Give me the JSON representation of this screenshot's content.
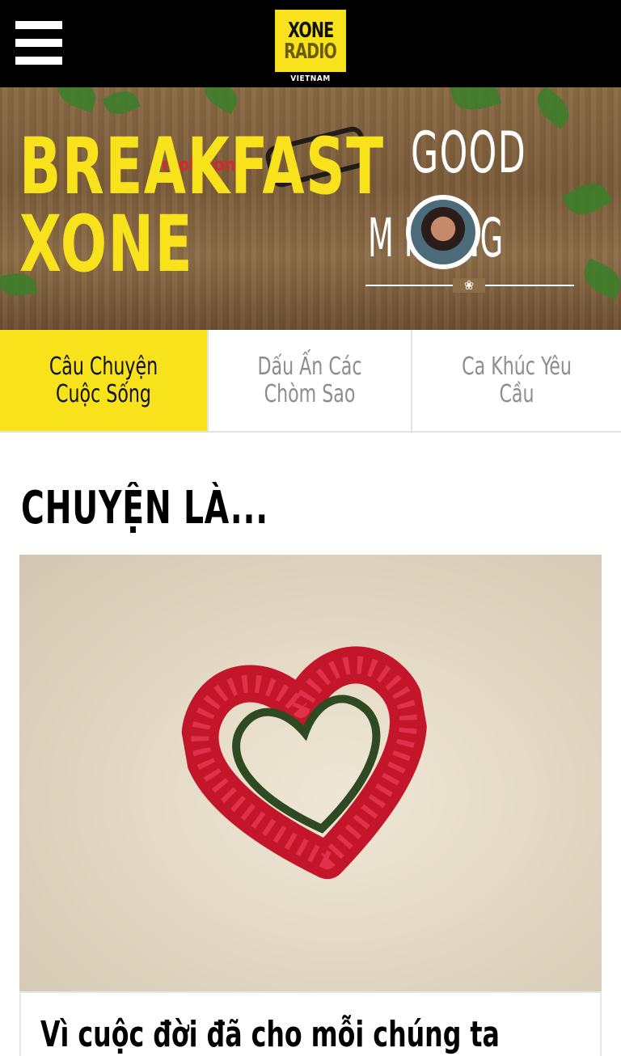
{
  "header": {
    "menu_icon": "hamburger-menu-icon",
    "logo": {
      "line1": "XONE",
      "line2": "RADIO",
      "sub": "VIETNAM"
    }
  },
  "banner": {
    "title_line1": "BREAKFAST",
    "title_line2": "XONE",
    "sponsor": "mobifone",
    "greeting_top": "GOOD",
    "greeting_bottom": "M  RNING"
  },
  "tabs": [
    {
      "label": "Câu Chuyện Cuộc Sống",
      "active": true
    },
    {
      "label": "Dấu Ấn Các Chòm Sao",
      "active": false
    },
    {
      "label": "Ca Khúc Yêu Cầu",
      "active": false
    }
  ],
  "section": {
    "title": "CHUYỆN LÀ...",
    "article": {
      "title": "Vì cuộc đời đã cho mỗi chúng ta",
      "image": "rose-heart-image"
    }
  },
  "colors": {
    "accent": "#f7e21c",
    "topbar": "#000000",
    "tab_inactive_text": "#8d8d8d"
  }
}
